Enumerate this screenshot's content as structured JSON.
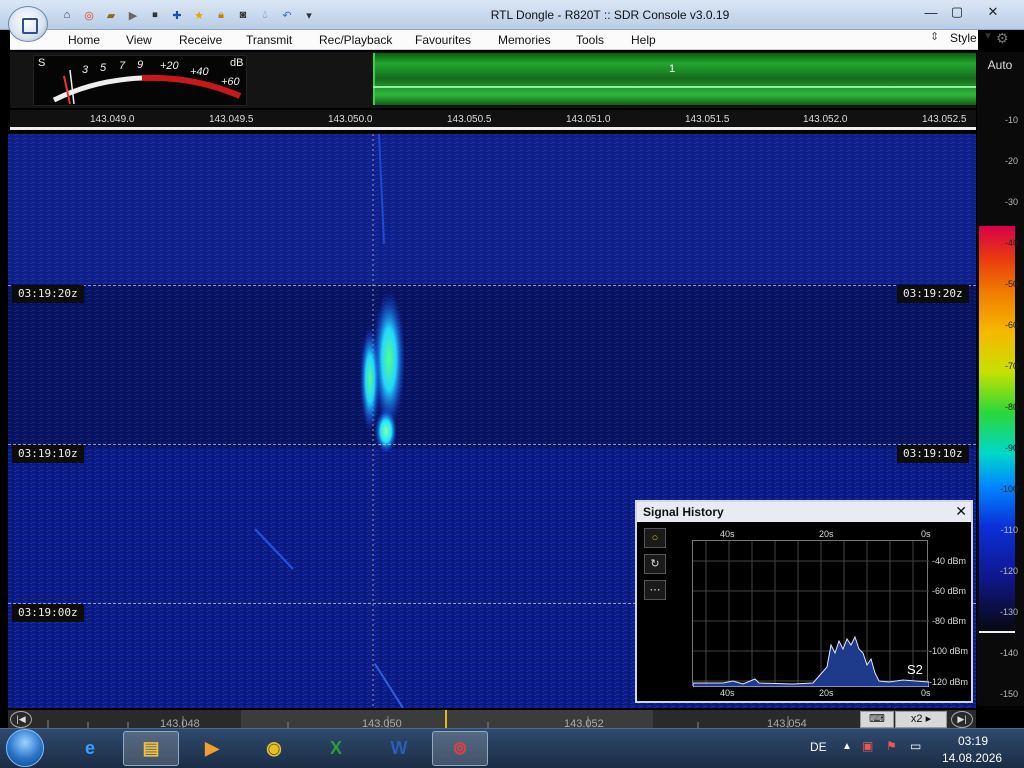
{
  "window": {
    "title": "RTL Dongle - R820T :: SDR Console v3.0.19",
    "minimize": "—",
    "maximize": "▢",
    "close": "✕"
  },
  "menu": {
    "items": [
      "Home",
      "View",
      "Receive",
      "Transmit",
      "Rec/Playback",
      "Favourites",
      "Memories",
      "Tools",
      "Help"
    ],
    "style_label": "Style"
  },
  "meter": {
    "s_label": "S",
    "scale": [
      "3",
      "5",
      "7",
      "9"
    ],
    "plus": [
      "+20",
      "+40",
      "+60"
    ],
    "unit": "dB"
  },
  "band": {
    "marker": "1"
  },
  "freq_axis": {
    "ticks": [
      "143.049.0",
      "143.049.5",
      "143.050.0",
      "143.050.5",
      "143.051.0",
      "143.051.5",
      "143.052.0",
      "143.052.5"
    ]
  },
  "scale": {
    "auto": "Auto",
    "ticks": [
      "-10",
      "-20",
      "-30",
      "-40",
      "-50",
      "-60",
      "-70",
      "-80",
      "-90",
      "-100",
      "-110",
      "-120",
      "-130",
      "-140",
      "-150"
    ]
  },
  "waterfall": {
    "times": [
      "03:19:20z",
      "03:19:10z",
      "03:19:00z"
    ]
  },
  "signal_history": {
    "title": "Signal History",
    "close": "✕",
    "top_ticks": [
      "40s",
      "20s",
      "0s"
    ],
    "bottom_ticks": [
      "40s",
      "20s",
      "0s"
    ],
    "dbm_ticks": [
      "-40 dBm",
      "-60 dBm",
      "-80 dBm",
      "-100 dBm",
      "-120 dBm"
    ],
    "s_reading": "S2",
    "buttons": [
      "○",
      "↻",
      "⋯"
    ]
  },
  "bottom_ruler": {
    "labels": [
      "143.048",
      "143.050",
      "143.052",
      "143.054"
    ],
    "zoom": "x2"
  },
  "taskbar": {
    "language": "DE",
    "time": "03:19",
    "date": "14.08.2026"
  },
  "colors": {
    "waterfall_bg": "#0b1a78",
    "band_green": "#22a62e",
    "taskbar": "#1a2d46"
  }
}
